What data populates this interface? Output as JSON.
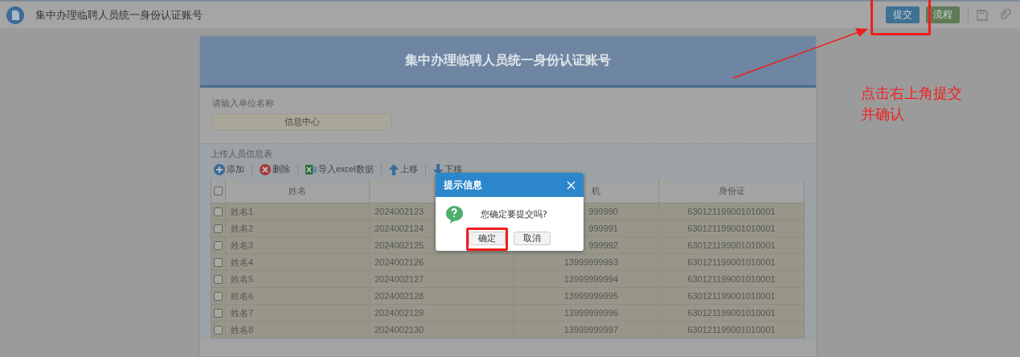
{
  "header": {
    "title": "集中办理临聘人员统一身份认证账号",
    "buttons": [
      {
        "label": "提交",
        "kind": "primary"
      },
      {
        "label": "流程",
        "kind": "success"
      }
    ]
  },
  "form": {
    "title": "集中办理临聘人员统一身份认证账号",
    "unit_label": "请输入单位名称",
    "unit_value": "信息中心",
    "table_label": "上传人员信息表",
    "toolbar": [
      {
        "label": "添加",
        "kind": "add"
      },
      {
        "label": "删除",
        "kind": "delete"
      },
      {
        "label": "导入excel数据",
        "kind": "excel"
      },
      {
        "label": "上移",
        "kind": "up"
      },
      {
        "label": "下移",
        "kind": "down"
      }
    ],
    "table": {
      "select_all": {
        "checked": false
      },
      "header": {
        "column_1": "姓名",
        "column_3": "机",
        "column_4": "身份证"
      },
      "rows": [
        {
          "checked": false,
          "column_1": "姓名1",
          "column_2": "2024002123",
          "column_3": "999990",
          "column_4": "630121199001010001"
        },
        {
          "checked": false,
          "column_1": "姓名2",
          "column_2": "2024002124",
          "column_3": "999991",
          "column_4": "630121199001010001"
        },
        {
          "checked": false,
          "column_1": "姓名3",
          "column_2": "2024002125",
          "column_3": "999992",
          "column_4": "630121199001010001"
        },
        {
          "checked": false,
          "column_1": "姓名4",
          "column_2": "2024002126",
          "column_3": "13999999993",
          "column_4": "630121199001010001"
        },
        {
          "checked": false,
          "column_1": "姓名5",
          "column_2": "2024002127",
          "column_3": "13999999994",
          "column_4": "630121199001010001"
        },
        {
          "checked": false,
          "column_1": "姓名6",
          "column_2": "2024002128",
          "column_3": "13999999995",
          "column_4": "630121199001010001"
        },
        {
          "checked": false,
          "column_1": "姓名7",
          "column_2": "2024002129",
          "column_3": "13999999996",
          "column_4": "630121199001010001"
        },
        {
          "checked": false,
          "column_1": "姓名8",
          "column_2": "2024002130",
          "column_3": "13999999997",
          "column_4": "630121199001010001"
        }
      ]
    }
  },
  "dialog": {
    "title": "提示信息",
    "message": "您确定要提交吗?",
    "buttons": [
      "确定",
      "取消"
    ]
  },
  "annotation": {
    "lines": [
      "点击右上角提交",
      "并确认"
    ]
  }
}
